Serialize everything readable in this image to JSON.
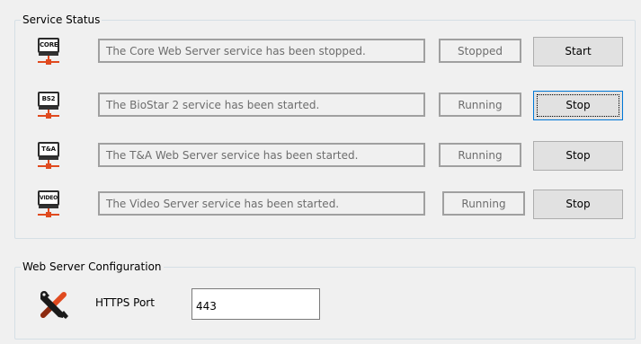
{
  "service_status": {
    "title": "Service Status",
    "rows": [
      {
        "icon_label": "CORE",
        "icon_name": "core-server-icon",
        "message": "The Core Web Server service has been stopped.",
        "status": "Stopped",
        "action": "Start",
        "focused": false
      },
      {
        "icon_label": "BS2",
        "icon_name": "biostar2-server-icon",
        "message": "The BioStar 2 service has been started.",
        "status": "Running",
        "action": "Stop",
        "focused": true
      },
      {
        "icon_label": "T&A",
        "icon_name": "ta-server-icon",
        "message": "The T&A Web Server service has been started.",
        "status": "Running",
        "action": "Stop",
        "focused": false
      },
      {
        "icon_label": "VIDEO",
        "icon_name": "video-server-icon",
        "message": "The Video Server service has been started.",
        "status": "Running",
        "action": "Stop",
        "focused": false
      }
    ]
  },
  "web_config": {
    "title": "Web Server Configuration",
    "icon_name": "tools-icon",
    "port_label": "HTTPS Port",
    "port_value": "443"
  },
  "colors": {
    "accent_orange": "#e04a1f",
    "focus_blue": "#0078d7"
  }
}
